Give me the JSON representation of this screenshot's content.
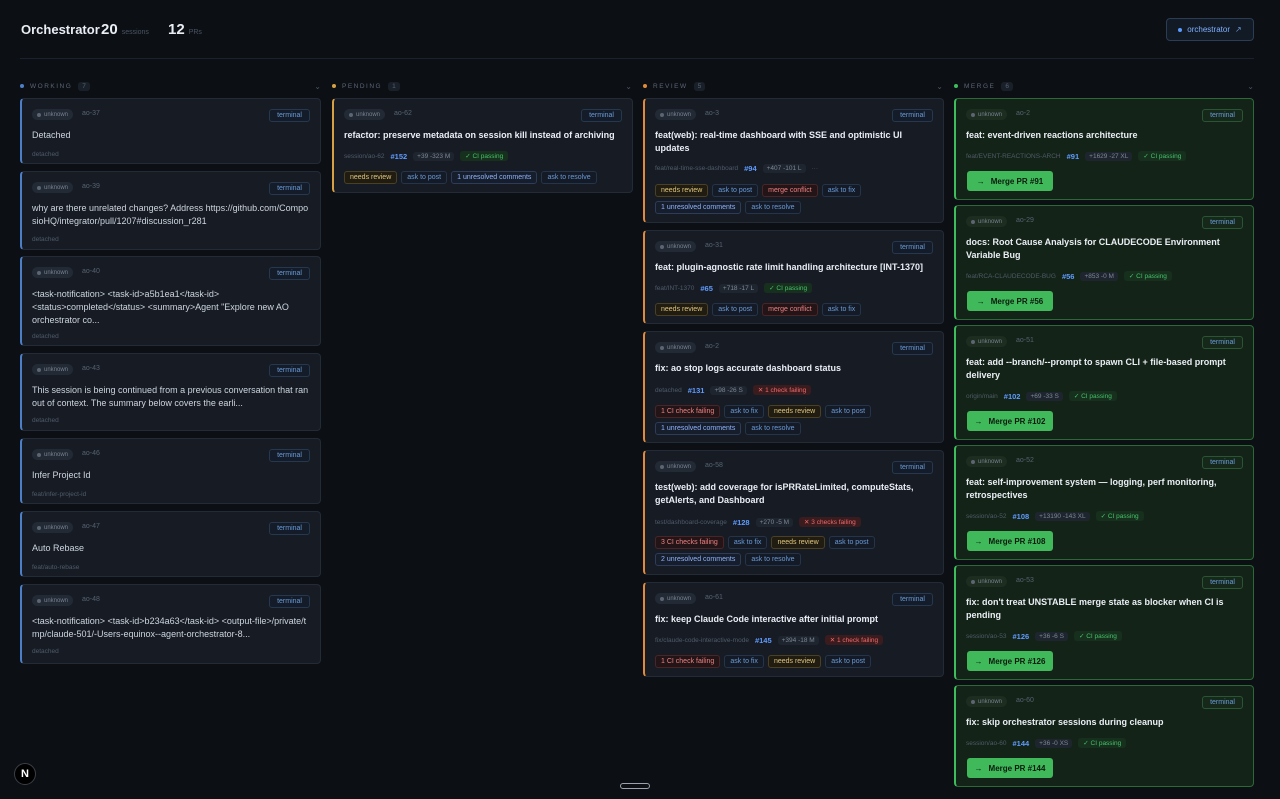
{
  "header": {
    "title": "Orchestrator",
    "sessions_count": "20",
    "sessions_label": "sessions",
    "prs_count": "12",
    "prs_label": "PRs",
    "orchestrator_button": "orchestrator"
  },
  "columns": {
    "working": {
      "label": "WORKING",
      "count": "7",
      "color": "#4d7fc8"
    },
    "pending": {
      "label": "PENDING",
      "count": "1",
      "color": "#d6a045"
    },
    "review": {
      "label": "REVIEW",
      "count": "5",
      "color": "#e08a3a"
    },
    "merge": {
      "label": "MERGE",
      "count": "6",
      "color": "#3fbd5c"
    }
  },
  "common": {
    "status": "unknown",
    "terminal": "terminal",
    "ci_passing": "✓ CI passing",
    "needs_review": "needs review",
    "ask_to_post": "ask to post",
    "merge_conflict": "merge conflict",
    "ask_to_fix": "ask to fix",
    "ask_to_resolve": "ask to resolve",
    "merge_icon": "arrow-right-icon"
  },
  "working": [
    {
      "id": "ao-37",
      "title": "Detached",
      "branch": "detached"
    },
    {
      "id": "ao-39",
      "title": "why are there unrelated changes? Address https://github.com/ComposioHQ/integrator/pull/1207#discussion_r281",
      "branch": "detached"
    },
    {
      "id": "ao-40",
      "title": "<task-notification> <task-id>a5b1ea1</task-id> <status>completed</status> <summary>Agent \"Explore new AO orchestrator co...",
      "branch": "detached"
    },
    {
      "id": "ao-43",
      "title": "This session is being continued from a previous conversation that ran out of context. The summary below covers the earli...",
      "branch": "detached"
    },
    {
      "id": "ao-46",
      "title": "Infer Project Id",
      "branch": "feat/infer-project-id"
    },
    {
      "id": "ao-47",
      "title": "Auto Rebase",
      "branch": "feat/auto-rebase"
    },
    {
      "id": "ao-48",
      "title": "<task-notification> <task-id>b234a63</task-id> <output-file>/private/tmp/claude-501/-Users-equinox--agent-orchestrator-8...",
      "branch": "detached"
    }
  ],
  "pending": [
    {
      "id": "ao-62",
      "title": "refactor: preserve metadata on session kill instead of archiving",
      "branch": "session/ao-62",
      "pr": "#152",
      "diff": "+39 -323 M",
      "unresolved": "1 unresolved comments"
    }
  ],
  "review": [
    {
      "id": "ao-3",
      "title": "feat(web): real-time dashboard with SSE and optimistic UI updates",
      "branch": "feat/real-time-sse-dashboard",
      "pr": "#94",
      "diff": "+407 -101 L",
      "extra": "···",
      "unresolved": "1 unresolved comments"
    },
    {
      "id": "ao-31",
      "title": "feat: plugin-agnostic rate limit handling architecture [INT-1370]",
      "branch": "feat/INT-1370",
      "pr": "#65",
      "diff": "+718 -17 L"
    },
    {
      "id": "ao-2",
      "title": "fix: ao stop logs accurate dashboard status",
      "branch": "detached",
      "pr": "#131",
      "diff": "+98 -26 S",
      "ci": "✕ 1 check failing",
      "ci_tag": "1 CI check failing",
      "unresolved": "1 unresolved comments"
    },
    {
      "id": "ao-58",
      "title": "test(web): add coverage for isPRRateLimited, computeStats, getAlerts, and Dashboard",
      "branch": "test/dashboard-coverage",
      "pr": "#128",
      "diff": "+270 -5 M",
      "ci": "✕ 3 checks failing",
      "ci_tag": "3 CI checks failing",
      "unresolved": "2 unresolved comments"
    },
    {
      "id": "ao-61",
      "title": "fix: keep Claude Code interactive after initial prompt",
      "branch": "fix/claude-code-interactive-mode",
      "pr": "#145",
      "diff": "+394 -18 M",
      "ci": "✕ 1 check failing",
      "ci_tag": "1 CI check failing"
    }
  ],
  "merge": [
    {
      "id": "ao-2",
      "title": "feat: event-driven reactions architecture",
      "branch": "feat/EVENT-REACTIONS-ARCH",
      "pr": "#91",
      "diff": "+1629 -27 XL",
      "button": "Merge PR #91"
    },
    {
      "id": "ao-29",
      "title": "docs: Root Cause Analysis for CLAUDECODE Environment Variable Bug",
      "branch": "feat/RCA-CLAUDECODE-BUG",
      "pr": "#56",
      "diff": "+853 -0 M",
      "button": "Merge PR #56"
    },
    {
      "id": "ao-51",
      "title": "feat: add --branch/--prompt to spawn CLI + file-based prompt delivery",
      "branch": "origin/main",
      "pr": "#102",
      "diff": "+69 -33 S",
      "button": "Merge PR #102"
    },
    {
      "id": "ao-52",
      "title": "feat: self-improvement system — logging, perf monitoring, retrospectives",
      "branch": "session/ao-52",
      "pr": "#108",
      "diff": "+13190 -143 XL",
      "button": "Merge PR #108"
    },
    {
      "id": "ao-53",
      "title": "fix: don't treat UNSTABLE merge state as blocker when CI is pending",
      "branch": "session/ao-53",
      "pr": "#126",
      "diff": "+36 -6 S",
      "button": "Merge PR #126"
    },
    {
      "id": "ao-60",
      "title": "fix: skip orchestrator sessions during cleanup",
      "branch": "session/ao-60",
      "pr": "#144",
      "diff": "+36 -0 XS",
      "button": "Merge PR #144"
    }
  ],
  "footer": {
    "logo": "N"
  }
}
